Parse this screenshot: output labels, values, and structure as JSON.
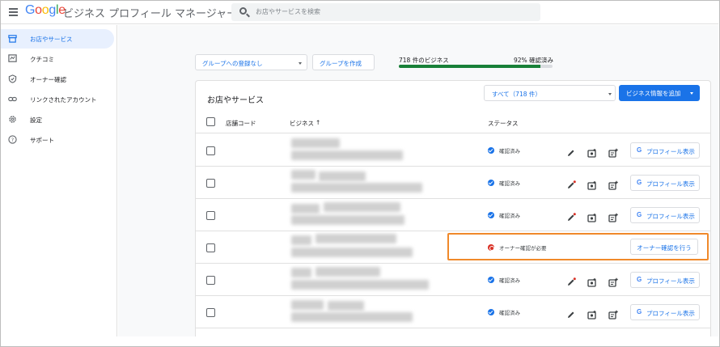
{
  "header": {
    "logo_letters": [
      {
        "char": "G",
        "color": "#4285f4"
      },
      {
        "char": "o",
        "color": "#ea4335"
      },
      {
        "char": "o",
        "color": "#fbbc05"
      },
      {
        "char": "g",
        "color": "#4285f4"
      },
      {
        "char": "l",
        "color": "#34a853"
      },
      {
        "char": "e",
        "color": "#ea4335"
      }
    ],
    "product_name": "ビジネス プロフィール マネージャー",
    "search_placeholder": "お店やサービスを検索"
  },
  "sidebar": {
    "items": [
      {
        "label": "お店やサービス",
        "icon": "storefront-icon",
        "active": true
      },
      {
        "label": "クチコミ",
        "icon": "reviews-icon",
        "active": false
      },
      {
        "label": "オーナー確認",
        "icon": "verified-shield-icon",
        "active": false
      },
      {
        "label": "リンクされたアカウント",
        "icon": "link-icon",
        "active": false
      },
      {
        "label": "設定",
        "icon": "gear-icon",
        "active": false
      },
      {
        "label": "サポート",
        "icon": "help-icon",
        "active": false
      }
    ]
  },
  "toolbar": {
    "group_dropdown": "グループへの登録なし",
    "create_group": "グループを作成",
    "business_count": "718 件のビジネス",
    "verified_percent_label": "92% 確認済み",
    "verified_fraction": 0.92
  },
  "card": {
    "title": "お店やサービス",
    "filter_label": "すべて（718 件）",
    "add_button": "ビジネス情報を追加"
  },
  "table": {
    "columns": {
      "store_code": "店舗コード",
      "business": "ビジネス",
      "sort_arrow": "↑",
      "status": "ステータス"
    },
    "rows": [
      {
        "status": "確認済み",
        "kind": "verified",
        "action": "プロフィール表示",
        "edit_icon": "pencil-icon"
      },
      {
        "status": "確認済み",
        "kind": "verified",
        "action": "プロフィール表示",
        "edit_icon": "pencil-dot-icon"
      },
      {
        "status": "確認済み",
        "kind": "verified",
        "action": "プロフィール表示",
        "edit_icon": "pencil-dot-icon"
      },
      {
        "status": "オーナー確認が必要",
        "kind": "needs_verification",
        "action": "オーナー確認を行う"
      },
      {
        "status": "確認済み",
        "kind": "verified",
        "action": "プロフィール表示",
        "edit_icon": "pencil-dot-icon"
      },
      {
        "status": "確認済み",
        "kind": "verified",
        "action": "プロフィール表示",
        "edit_icon": "pencil-icon"
      }
    ]
  },
  "profile_g": "G",
  "colors": {
    "accent": "#1a73e8",
    "verified": "#1a73e8",
    "alert": "#d93025",
    "progress": "#188038",
    "highlight": "#f0892a"
  }
}
